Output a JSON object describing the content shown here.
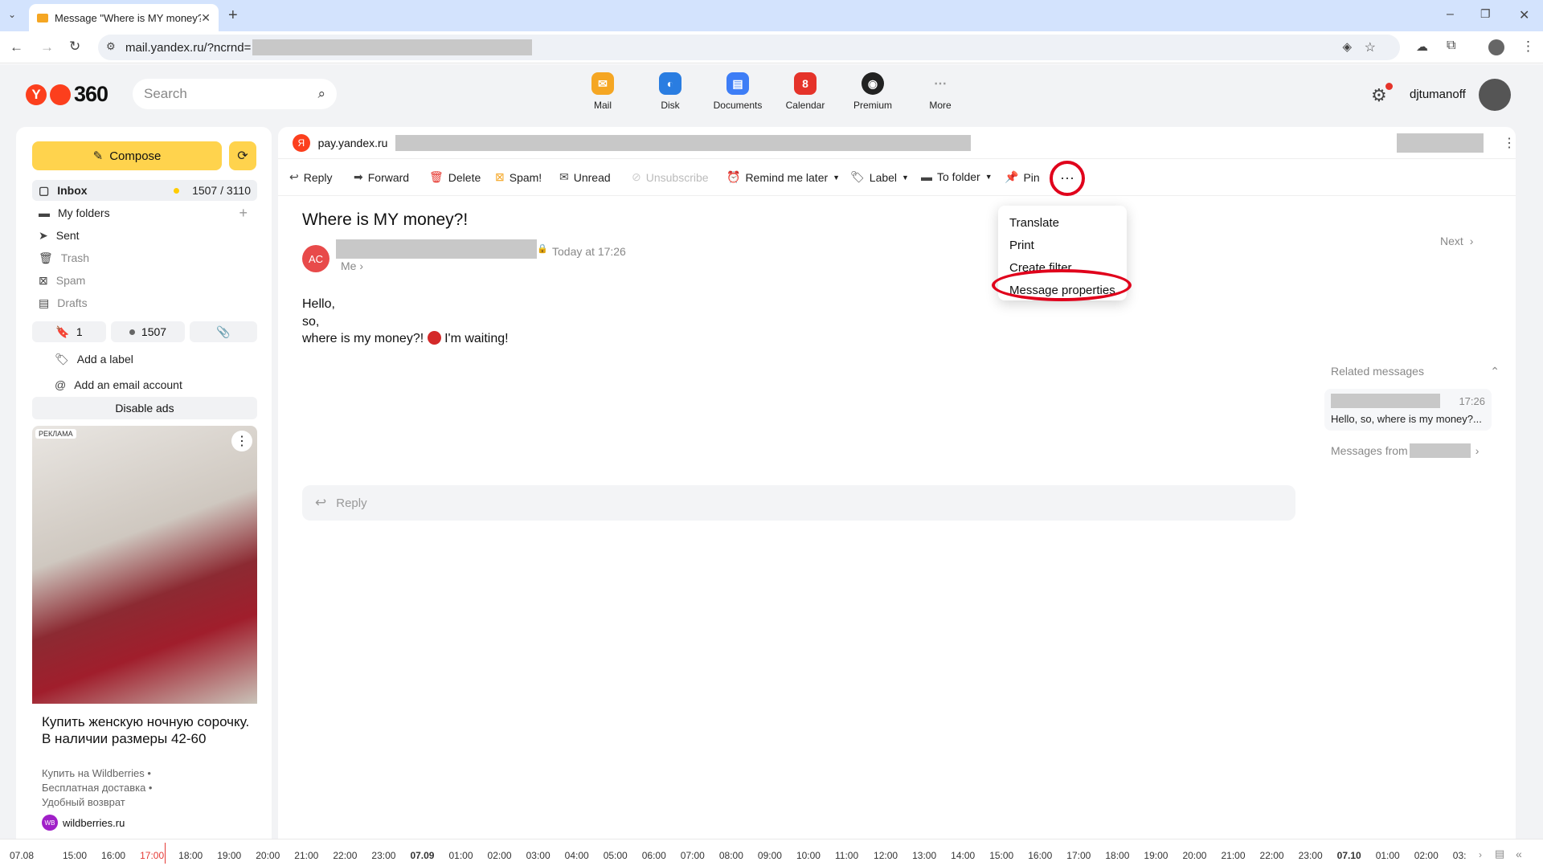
{
  "browser": {
    "tab_title": "Message \"Where is MY money?!",
    "url": "mail.yandex.ru/?ncrnd="
  },
  "header": {
    "logo": "360",
    "search_placeholder": "Search",
    "services": [
      {
        "label": "Mail",
        "color": "#f5a623"
      },
      {
        "label": "Disk",
        "color": "#2a7de1"
      },
      {
        "label": "Documents",
        "color": "#3d7df6"
      },
      {
        "label": "Calendar",
        "color": "#e5332a",
        "badge": "8"
      },
      {
        "label": "Premium",
        "color": "#222222"
      },
      {
        "label": "More",
        "color": "#999999"
      }
    ],
    "username": "djtumanoff"
  },
  "sidebar": {
    "compose": "Compose",
    "folders": [
      {
        "label": "Inbox",
        "count": "1507 / 3110"
      },
      {
        "label": "My folders"
      },
      {
        "label": "Sent"
      },
      {
        "label": "Trash"
      },
      {
        "label": "Spam"
      },
      {
        "label": "Drafts"
      }
    ],
    "chips": [
      "1",
      "1507"
    ],
    "add_label": "Add a label",
    "add_account": "Add an email account",
    "disable_ads": "Disable ads",
    "ad": {
      "badge": "РЕКЛАМА",
      "title": "Купить женскую ночную сорочку. В наличии размеры 42-60",
      "lines": [
        "Купить на Wildberries •",
        "Бесплатная доставка •",
        "Удобный возврат"
      ],
      "domain": "wildberries.ru",
      "domain_icon": "WB"
    }
  },
  "message": {
    "from_domain": "pay.yandex.ru",
    "actions": [
      "Reply",
      "Forward",
      "Delete",
      "Spam!",
      "Unread",
      "Unsubscribe",
      "Remind me later",
      "Label",
      "To folder",
      "Pin"
    ],
    "more_menu": [
      "Translate",
      "Print",
      "Create filter",
      "Message properties"
    ],
    "subject": "Where is MY money?!",
    "avatar_initials": "AC",
    "date": "Today at 17:26",
    "to": "Me",
    "body": [
      "Hello,",
      "so,",
      "where is my money?!",
      "I'm waiting!"
    ],
    "reply_placeholder": "Reply",
    "next": "Next",
    "related_title": "Related messages",
    "related_time": "17:26",
    "related_snippet": "Hello, so, where is my money?...",
    "messages_from": "Messages from"
  },
  "timeline": [
    "07.08",
    "15:00",
    "16:00",
    "17:00",
    "18:00",
    "19:00",
    "20:00",
    "21:00",
    "22:00",
    "23:00",
    "07.09",
    "01:00",
    "02:00",
    "03:00",
    "04:00",
    "05:00",
    "06:00",
    "07:00",
    "08:00",
    "09:00",
    "10:00",
    "11:00",
    "12:00",
    "13:00",
    "14:00",
    "15:00",
    "16:00",
    "17:00",
    "18:00",
    "19:00",
    "20:00",
    "21:00",
    "22:00",
    "23:00",
    "07.10",
    "01:00",
    "02:00",
    "03:"
  ]
}
